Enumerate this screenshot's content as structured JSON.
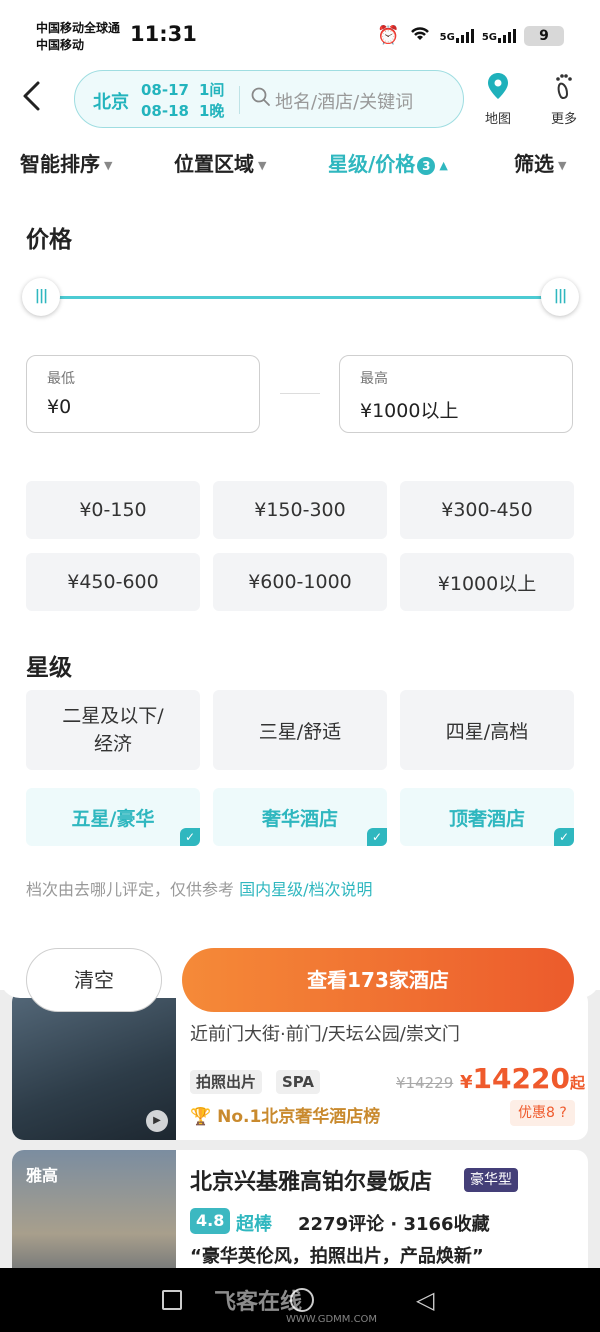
{
  "status": {
    "carrier1": "中国移动全球通",
    "carrier2": "中国移动",
    "time": "11:31",
    "net1": "5G",
    "net2": "5G",
    "battery": "9"
  },
  "header": {
    "city": "北京",
    "checkin": "08-17",
    "checkout": "08-18",
    "rooms": "1间",
    "nights": "1晚",
    "search_placeholder": "地名/酒店/关键词",
    "map_label": "地图",
    "more_label": "更多"
  },
  "tabs": [
    {
      "label": "智能排序"
    },
    {
      "label": "位置区域"
    },
    {
      "label": "星级/价格",
      "badge": "3"
    },
    {
      "label": "筛选"
    }
  ],
  "price": {
    "title": "价格",
    "slider_min_fraction": 0.0,
    "slider_max_fraction": 1.0,
    "min_label": "最低",
    "min_value": "¥0",
    "max_label": "最高",
    "max_value": "¥1000以上",
    "options": [
      "¥0-150",
      "¥150-300",
      "¥300-450",
      "¥450-600",
      "¥600-1000",
      "¥1000以上"
    ]
  },
  "star": {
    "title": "星级",
    "options": [
      {
        "label": "二星及以下/经济",
        "selected": false
      },
      {
        "label": "三星/舒适",
        "selected": false
      },
      {
        "label": "四星/高档",
        "selected": false
      },
      {
        "label": "五星/豪华",
        "selected": true
      },
      {
        "label": "奢华酒店",
        "selected": true
      },
      {
        "label": "顶奢酒店",
        "selected": true
      }
    ]
  },
  "note": {
    "text": "档次由去哪儿评定，仅供参考",
    "link": "国内星级/档次说明"
  },
  "actions": {
    "clear": "清空",
    "view": "查看173家酒店"
  },
  "list": {
    "card1": {
      "address": "近前门大街·前门/天坛公园/崇文门",
      "tags": [
        "拍照出片",
        "SPA"
      ],
      "old_price": "¥14229",
      "currency": "¥",
      "price": "14220",
      "price_suffix": "起",
      "rank": "No.1北京奢华酒店榜",
      "discount": "优惠8"
    },
    "card2": {
      "logo": "雅高",
      "name": "北京兴基雅高铂尔曼饭店",
      "type": "豪华型",
      "score": "4.8",
      "score_text": "超棒",
      "stats": "2279评论 · 3166收藏",
      "quote": "“豪华英伦风，拍照出片，产品焕新”"
    }
  },
  "watermark": {
    "text": "飞客在线",
    "url": "WWW.GDMM.COM"
  },
  "colors": {
    "accent": "#2fb7bf",
    "orange": "#ef5a2c"
  }
}
